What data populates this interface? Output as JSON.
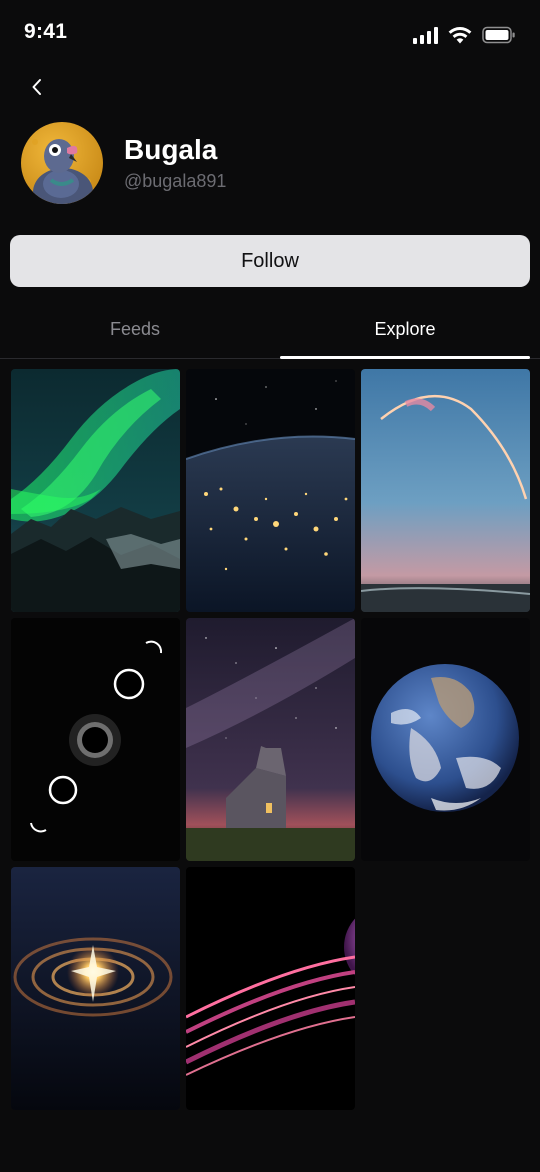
{
  "status_bar": {
    "time": "9:41",
    "icons": [
      "signal-icon",
      "wifi-icon",
      "battery-icon"
    ]
  },
  "nav": {
    "back_icon": "chevron-left-icon"
  },
  "profile": {
    "name": "Bugala",
    "handle": "@bugala891",
    "avatar": "pigeon-avatar"
  },
  "actions": {
    "follow_label": "Follow"
  },
  "tabs": [
    {
      "label": "Feeds",
      "active": false
    },
    {
      "label": "Explore",
      "active": true
    }
  ],
  "explore_grid": {
    "items": [
      {
        "subject": "aurora"
      },
      {
        "subject": "earth-night-lights"
      },
      {
        "subject": "rocket-launch-trail"
      },
      {
        "subject": "solar-eclipse-sequence"
      },
      {
        "subject": "milky-way-church"
      },
      {
        "subject": "blue-marble-earth"
      },
      {
        "subject": "spiral-galaxy"
      },
      {
        "subject": "ringed-planet"
      }
    ]
  },
  "colors": {
    "background": "#0b0b0c",
    "follow_button_bg": "#e4e4e7",
    "handle_text": "#6c6c72",
    "inactive_tab": "#8a8a90",
    "active_tab": "#ffffff"
  }
}
